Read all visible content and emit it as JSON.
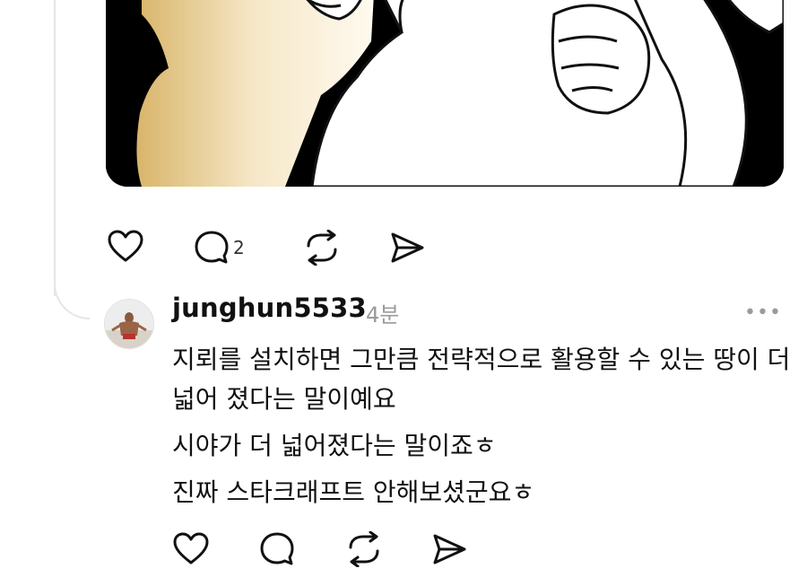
{
  "post": {
    "image_alt": "cartoon-meme-image",
    "actions": {
      "like_icon": "heart-icon",
      "comment_icon": "comment-icon",
      "comment_count": "2",
      "repost_icon": "repost-icon",
      "share_icon": "send-icon"
    }
  },
  "reply": {
    "username": "junghun5533",
    "timestamp": "4분",
    "more_icon": "more-icon",
    "more_glyph": "•••",
    "lines": [
      "지뢰를 설치하면 그만큼 전략적으로 활용할 수 있는 땅이 더 넓어 졌다는 말이예요",
      "시야가 더 넓어졌다는 말이죠ㅎ",
      "진짜 스타크래프트 안해보셨군요ㅎ"
    ],
    "actions": {
      "like_icon": "heart-icon",
      "comment_icon": "comment-icon",
      "repost_icon": "repost-icon",
      "share_icon": "send-icon"
    }
  },
  "colors": {
    "text": "#111111",
    "muted": "#9a9a9a",
    "thread_line": "#e6e6e6",
    "background": "#ffffff"
  }
}
